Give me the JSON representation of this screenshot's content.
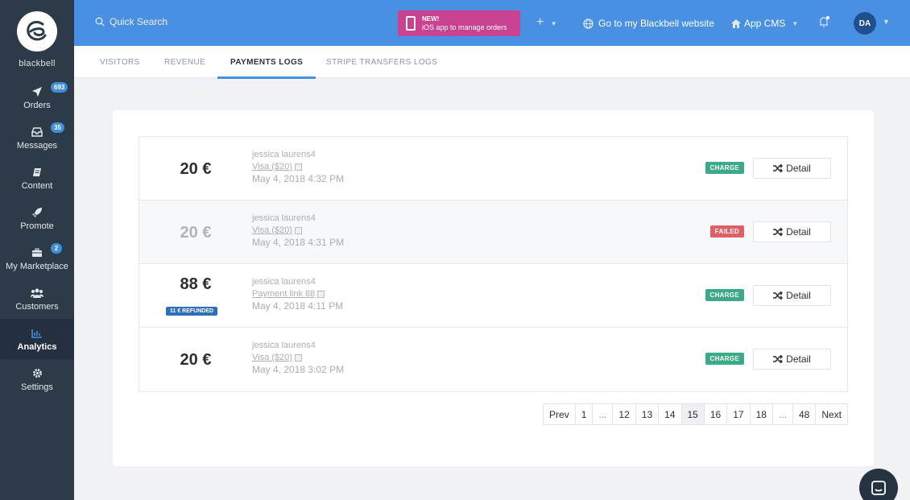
{
  "brand": {
    "name": "blackbell"
  },
  "sidebar": {
    "items": [
      {
        "label": "Orders",
        "badge": "693",
        "icon": "send-icon"
      },
      {
        "label": "Messages",
        "badge": "35",
        "icon": "inbox-icon"
      },
      {
        "label": "Content",
        "badge": "",
        "icon": "book-icon"
      },
      {
        "label": "Promote",
        "badge": "",
        "icon": "rocket-icon"
      },
      {
        "label": "My Marketplace",
        "badge": "2",
        "icon": "briefcase-icon"
      },
      {
        "label": "Customers",
        "badge": "",
        "icon": "users-icon"
      },
      {
        "label": "Analytics",
        "badge": "",
        "icon": "bar-chart-icon"
      },
      {
        "label": "Settings",
        "badge": "",
        "icon": "gear-icon"
      }
    ]
  },
  "topbar": {
    "search_placeholder": "Quick Search",
    "promo_new": "NEW!",
    "promo_text": "iOS app to manage orders",
    "plus": "+",
    "website": "Go to my Blackbell website",
    "app_cms": "App CMS",
    "avatar": "DA"
  },
  "tabs": [
    {
      "label": "VISITORS"
    },
    {
      "label": "REVENUE"
    },
    {
      "label": "PAYMENTS LOGS"
    },
    {
      "label": "STRIPE TRANSFERS LOGS"
    }
  ],
  "payments": [
    {
      "amount": "20 €",
      "name": "jessica laurens4",
      "method": "Visa ($20)",
      "date": "May 4, 2018 4:32 PM",
      "status": "CHARGE",
      "refund": "",
      "detail": "Detail"
    },
    {
      "amount": "20 €",
      "name": "jessica laurens4",
      "method": "Visa ($20)",
      "date": "May 4, 2018 4:31 PM",
      "status": "FAILED",
      "refund": "",
      "detail": "Detail"
    },
    {
      "amount": "88 €",
      "name": "jessica laurens4",
      "method": "Payment link 88",
      "date": "May 4, 2018 4:11 PM",
      "status": "CHARGE",
      "refund": "11 € REFUNDED",
      "detail": "Detail"
    },
    {
      "amount": "20 €",
      "name": "jessica laurens4",
      "method": "Visa ($20)",
      "date": "May 4, 2018 3:02 PM",
      "status": "CHARGE",
      "refund": "",
      "detail": "Detail"
    }
  ],
  "pagination": {
    "pages": [
      "Prev",
      "1",
      "...",
      "12",
      "13",
      "14",
      "15",
      "16",
      "17",
      "18",
      "...",
      "48",
      "Next"
    ],
    "current": "15"
  },
  "colors": {
    "accent": "#4a90e2",
    "sidebar": "#2d3a48",
    "charge": "#3aaa87",
    "failed": "#e05f66",
    "promo": "#c9428f"
  }
}
